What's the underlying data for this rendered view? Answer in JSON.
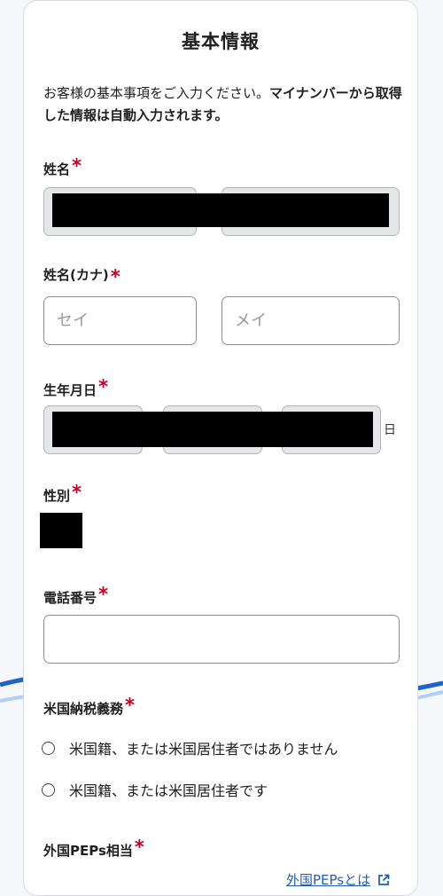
{
  "title": "基本情報",
  "description": {
    "normal": "お客様の基本事項をご入力ください。",
    "bold": "マイナンバーから取得した情報は自動入力されます。"
  },
  "required_mark": "*",
  "fields": {
    "name": {
      "label": "姓名"
    },
    "name_kana": {
      "label": "姓名(カナ)",
      "sei_placeholder": "セイ",
      "mei_placeholder": "メイ"
    },
    "birthday": {
      "label": "生年月日",
      "day_suffix": "日"
    },
    "gender": {
      "label": "性別"
    },
    "phone": {
      "label": "電話番号",
      "value": ""
    },
    "us_tax": {
      "label": "米国納税義務",
      "options": [
        "米国籍、または米国居住者ではありません",
        "米国籍、または米国居住者です"
      ]
    },
    "peps": {
      "label": "外国PEPs相当",
      "link": "外国PEPsとは"
    }
  },
  "colors": {
    "required": "#c00020",
    "link": "#1f5fb5",
    "wave": "#1e64c8"
  },
  "icons": [
    "external-link-icon",
    "radio-icon"
  ]
}
